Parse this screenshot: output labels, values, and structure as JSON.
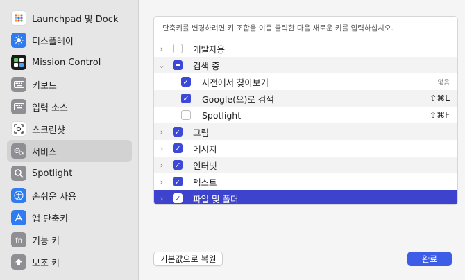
{
  "sidebar": {
    "items": [
      {
        "label": "Launchpad 및 Dock",
        "icon": "launchpad-icon",
        "color": "#ffffff"
      },
      {
        "label": "디스플레이",
        "icon": "display-icon",
        "color": "#2f7bf0"
      },
      {
        "label": "Mission Control",
        "icon": "mission-control-icon",
        "color": "#1a1a1a"
      },
      {
        "label": "키보드",
        "icon": "keyboard-icon",
        "color": "#8e8e93"
      },
      {
        "label": "입력 소스",
        "icon": "input-sources-icon",
        "color": "#8e8e93"
      },
      {
        "label": "스크린샷",
        "icon": "screenshot-icon",
        "color": "#ffffff"
      },
      {
        "label": "서비스",
        "icon": "gear-icon",
        "color": "#8e8e93"
      },
      {
        "label": "Spotlight",
        "icon": "spotlight-icon",
        "color": "#8e8e93"
      },
      {
        "label": "손쉬운 사용",
        "icon": "accessibility-icon",
        "color": "#2f7bf0"
      },
      {
        "label": "앱 단축키",
        "icon": "app-shortcuts-icon",
        "color": "#2f7bf0"
      },
      {
        "label": "기능 키",
        "icon": "function-key-icon",
        "color": "#8e8e93"
      },
      {
        "label": "보조 키",
        "icon": "modifier-key-icon",
        "color": "#8e8e93"
      }
    ],
    "selected_index": 6
  },
  "main": {
    "description": "단축키를 변경하려면 키 조합을 이중 클릭한 다음 새로운 키를 입력하십시오.",
    "rows": [
      {
        "label": "개발자용",
        "checkbox": "unchecked",
        "chevron": "›",
        "shortcut": ""
      },
      {
        "label": "검색 중",
        "checkbox": "mixed",
        "chevron": "⌄",
        "shortcut": ""
      },
      {
        "label": "사전에서 찾아보기",
        "checkbox": "checked",
        "chevron": "",
        "shortcut": "없음"
      },
      {
        "label": "Google(으)로 검색",
        "checkbox": "checked",
        "chevron": "",
        "shortcut": "⇧⌘L"
      },
      {
        "label": "Spotlight",
        "checkbox": "unchecked",
        "chevron": "",
        "shortcut": "⇧⌘F"
      },
      {
        "label": "그림",
        "checkbox": "checked",
        "chevron": "›",
        "shortcut": ""
      },
      {
        "label": "메시지",
        "checkbox": "checked",
        "chevron": "›",
        "shortcut": ""
      },
      {
        "label": "인터넷",
        "checkbox": "checked",
        "chevron": "›",
        "shortcut": ""
      },
      {
        "label": "텍스트",
        "checkbox": "checked",
        "chevron": "›",
        "shortcut": ""
      },
      {
        "label": "파일 및 폴더",
        "checkbox": "checked",
        "chevron": "›",
        "shortcut": ""
      }
    ],
    "restore_button": "기본값으로 복원",
    "done_button": "완료",
    "accent_color": "#3d43cc"
  }
}
